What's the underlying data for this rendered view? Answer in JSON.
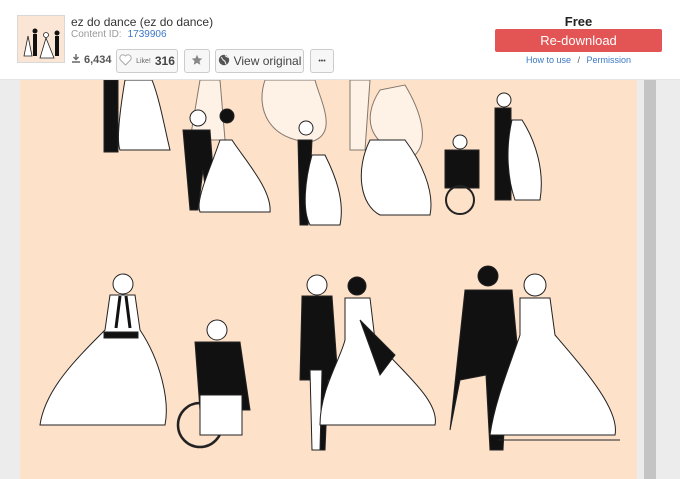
{
  "item": {
    "title": "ez do dance (ez do dance)",
    "content_id_label": "Content ID:",
    "content_id": "1739906"
  },
  "stats": {
    "downloads": "6,434",
    "like_label": "Like!",
    "like_count": "316"
  },
  "actions": {
    "view_original": "View original",
    "more": "•••"
  },
  "purchase": {
    "price": "Free",
    "redownload": "Re-download",
    "how_to_use": "How to use",
    "separator": "/",
    "permission": "Permission"
  },
  "icons": {
    "download": "download-icon",
    "like": "heart-icon",
    "favorite": "star-icon",
    "view": "globe-icon",
    "more": "ellipsis-icon"
  },
  "colors": {
    "accent_red": "#e35555",
    "link_blue": "#3b78c4",
    "canvas_bg": "#fde1c9"
  }
}
